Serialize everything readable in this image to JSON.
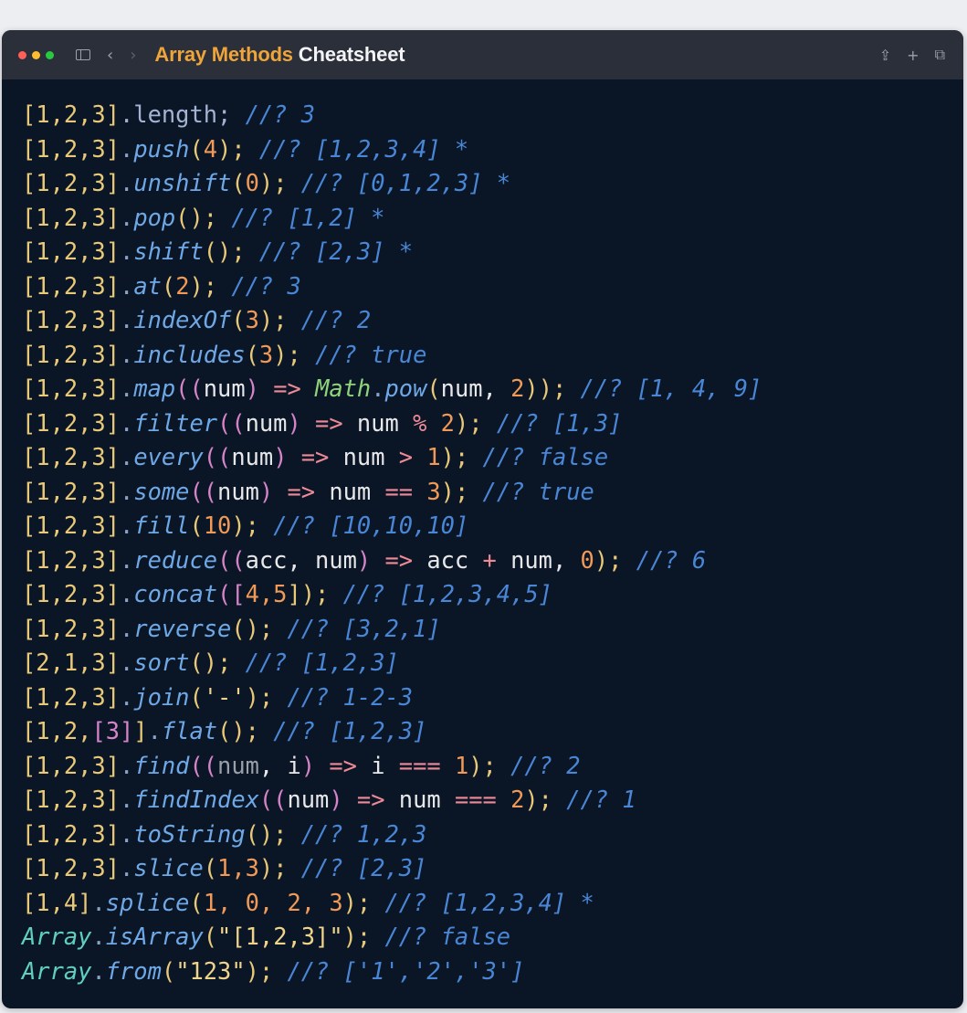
{
  "window": {
    "title_highlight": "Array Methods",
    "title_rest": "Cheatsheet",
    "traffic_lights": [
      "#ff5f57",
      "#febc2e",
      "#28c840"
    ],
    "icons": [
      "sidebar-icon",
      "back-icon",
      "forward-icon",
      "share-icon",
      "plus-icon",
      "tabs-icon"
    ],
    "glyphs": {
      "back": "‹",
      "forward": "›",
      "share": "⇪",
      "plus": "+",
      "tabs": "⧉"
    }
  },
  "colors": {
    "background": "#0a1626",
    "titlebar": "#2a2f39",
    "title_accent": "#f0a53a"
  },
  "code_lines": [
    [
      [
        "[1,2,3]",
        "y"
      ],
      [
        ".length;",
        "k"
      ],
      [
        " //? 3",
        "c"
      ]
    ],
    [
      [
        "[1,2,3]",
        "y"
      ],
      [
        ".",
        "s"
      ],
      [
        "push",
        "m"
      ],
      [
        "(",
        "y"
      ],
      [
        "4",
        "o"
      ],
      [
        ");",
        "y"
      ],
      [
        " //? [1,2,3,4] *",
        "c"
      ]
    ],
    [
      [
        "[1,2,3]",
        "y"
      ],
      [
        ".",
        "s"
      ],
      [
        "unshift",
        "m"
      ],
      [
        "(",
        "y"
      ],
      [
        "0",
        "o"
      ],
      [
        ");",
        "y"
      ],
      [
        " //? [0,1,2,3] *",
        "c"
      ]
    ],
    [
      [
        "[1,2,3]",
        "y"
      ],
      [
        ".",
        "s"
      ],
      [
        "pop",
        "m"
      ],
      [
        "();",
        "y"
      ],
      [
        " //? [1,2] *",
        "c"
      ]
    ],
    [
      [
        "[1,2,3]",
        "y"
      ],
      [
        ".",
        "s"
      ],
      [
        "shift",
        "m"
      ],
      [
        "();",
        "y"
      ],
      [
        " //? [2,3] *",
        "c"
      ]
    ],
    [
      [
        "[1,2,3]",
        "y"
      ],
      [
        ".",
        "s"
      ],
      [
        "at",
        "m"
      ],
      [
        "(",
        "y"
      ],
      [
        "2",
        "o"
      ],
      [
        ");",
        "y"
      ],
      [
        " //? 3",
        "c"
      ]
    ],
    [
      [
        "[1,2,3]",
        "y"
      ],
      [
        ".",
        "s"
      ],
      [
        "indexOf",
        "m"
      ],
      [
        "(",
        "y"
      ],
      [
        "3",
        "o"
      ],
      [
        ");",
        "y"
      ],
      [
        " //? 2",
        "c"
      ]
    ],
    [
      [
        "[1,2,3]",
        "y"
      ],
      [
        ".",
        "s"
      ],
      [
        "includes",
        "m"
      ],
      [
        "(",
        "y"
      ],
      [
        "3",
        "o"
      ],
      [
        ");",
        "y"
      ],
      [
        " //? true",
        "c"
      ]
    ],
    [
      [
        "[1,2,3]",
        "y"
      ],
      [
        ".",
        "s"
      ],
      [
        "map",
        "m"
      ],
      [
        "((",
        "p"
      ],
      [
        "num",
        "w"
      ],
      [
        ")",
        "p"
      ],
      [
        " => ",
        "r"
      ],
      [
        "Math",
        "g"
      ],
      [
        ".",
        "s"
      ],
      [
        "pow",
        "m"
      ],
      [
        "(",
        "y"
      ],
      [
        "num, ",
        "w"
      ],
      [
        "2",
        "o"
      ],
      [
        "));",
        "y"
      ],
      [
        " //? [1, 4, 9]",
        "c"
      ]
    ],
    [
      [
        "[1,2,3]",
        "y"
      ],
      [
        ".",
        "s"
      ],
      [
        "filter",
        "m"
      ],
      [
        "((",
        "p"
      ],
      [
        "num",
        "w"
      ],
      [
        ")",
        "p"
      ],
      [
        " => ",
        "r"
      ],
      [
        "num ",
        "w"
      ],
      [
        "% ",
        "r"
      ],
      [
        "2",
        "o"
      ],
      [
        ");",
        "y"
      ],
      [
        " //? [1,3]",
        "c"
      ]
    ],
    [
      [
        "[1,2,3]",
        "y"
      ],
      [
        ".",
        "s"
      ],
      [
        "every",
        "m"
      ],
      [
        "((",
        "p"
      ],
      [
        "num",
        "w"
      ],
      [
        ")",
        "p"
      ],
      [
        " => ",
        "r"
      ],
      [
        "num ",
        "w"
      ],
      [
        "> ",
        "r"
      ],
      [
        "1",
        "o"
      ],
      [
        ");",
        "y"
      ],
      [
        " //? false",
        "c"
      ]
    ],
    [
      [
        "[1,2,3]",
        "y"
      ],
      [
        ".",
        "s"
      ],
      [
        "some",
        "m"
      ],
      [
        "((",
        "p"
      ],
      [
        "num",
        "w"
      ],
      [
        ")",
        "p"
      ],
      [
        " => ",
        "r"
      ],
      [
        "num ",
        "w"
      ],
      [
        "== ",
        "r"
      ],
      [
        "3",
        "o"
      ],
      [
        ");",
        "y"
      ],
      [
        " //? true",
        "c"
      ]
    ],
    [
      [
        "[1,2,3]",
        "y"
      ],
      [
        ".",
        "s"
      ],
      [
        "fill",
        "m"
      ],
      [
        "(",
        "y"
      ],
      [
        "10",
        "o"
      ],
      [
        ");",
        "y"
      ],
      [
        " //? [10,10,10]",
        "c"
      ]
    ],
    [
      [
        "[1,2,3]",
        "y"
      ],
      [
        ".",
        "s"
      ],
      [
        "reduce",
        "m"
      ],
      [
        "((",
        "p"
      ],
      [
        "acc, num",
        "w"
      ],
      [
        ")",
        "p"
      ],
      [
        " => ",
        "r"
      ],
      [
        "acc ",
        "w"
      ],
      [
        "+ ",
        "r"
      ],
      [
        "num, ",
        "w"
      ],
      [
        "0",
        "o"
      ],
      [
        ");",
        "y"
      ],
      [
        " //? 6",
        "c"
      ]
    ],
    [
      [
        "[1,2,3]",
        "y"
      ],
      [
        ".",
        "s"
      ],
      [
        "concat",
        "m"
      ],
      [
        "([",
        "p"
      ],
      [
        "4,5",
        "o"
      ],
      [
        "]);",
        "y"
      ],
      [
        " //? [1,2,3,4,5]",
        "c"
      ]
    ],
    [
      [
        "[1,2,3]",
        "y"
      ],
      [
        ".",
        "s"
      ],
      [
        "reverse",
        "m"
      ],
      [
        "();",
        "y"
      ],
      [
        " //? [3,2,1]",
        "c"
      ]
    ],
    [
      [
        "[2,1,3]",
        "y"
      ],
      [
        ".",
        "s"
      ],
      [
        "sort",
        "m"
      ],
      [
        "();",
        "y"
      ],
      [
        " //? [1,2,3]",
        "c"
      ]
    ],
    [
      [
        "[1,2,3]",
        "y"
      ],
      [
        ".",
        "s"
      ],
      [
        "join",
        "m"
      ],
      [
        "(",
        "y"
      ],
      [
        "'-'",
        "q"
      ],
      [
        ");",
        "y"
      ],
      [
        " //? 1-2-3",
        "c"
      ]
    ],
    [
      [
        "[1,2,",
        "y"
      ],
      [
        "[3]",
        "p"
      ],
      [
        "]",
        "y"
      ],
      [
        ".",
        "s"
      ],
      [
        "flat",
        "m"
      ],
      [
        "();",
        "y"
      ],
      [
        " //? [1,2,3]",
        "c"
      ]
    ],
    [
      [
        "[1,2,3]",
        "y"
      ],
      [
        ".",
        "s"
      ],
      [
        "find",
        "m"
      ],
      [
        "((",
        "p"
      ],
      [
        "num",
        "d"
      ],
      [
        ", i",
        "w"
      ],
      [
        ")",
        "p"
      ],
      [
        " => ",
        "r"
      ],
      [
        "i ",
        "w"
      ],
      [
        "=== ",
        "r"
      ],
      [
        "1",
        "o"
      ],
      [
        ");",
        "y"
      ],
      [
        " //? 2",
        "c"
      ]
    ],
    [
      [
        "[1,2,3]",
        "y"
      ],
      [
        ".",
        "s"
      ],
      [
        "findIndex",
        "m"
      ],
      [
        "((",
        "p"
      ],
      [
        "num",
        "w"
      ],
      [
        ")",
        "p"
      ],
      [
        " => ",
        "r"
      ],
      [
        "num ",
        "w"
      ],
      [
        "=== ",
        "r"
      ],
      [
        "2",
        "o"
      ],
      [
        ");",
        "y"
      ],
      [
        " //? 1",
        "c"
      ]
    ],
    [
      [
        "[1,2,3]",
        "y"
      ],
      [
        ".",
        "s"
      ],
      [
        "toString",
        "m"
      ],
      [
        "();",
        "y"
      ],
      [
        " //? 1,2,3",
        "c"
      ]
    ],
    [
      [
        "[1,2,3]",
        "y"
      ],
      [
        ".",
        "s"
      ],
      [
        "slice",
        "m"
      ],
      [
        "(",
        "y"
      ],
      [
        "1,3",
        "o"
      ],
      [
        ");",
        "y"
      ],
      [
        " //? [2,3]",
        "c"
      ]
    ],
    [
      [
        "[1,4]",
        "y"
      ],
      [
        ".",
        "s"
      ],
      [
        "splice",
        "m"
      ],
      [
        "(",
        "y"
      ],
      [
        "1, 0, 2, 3",
        "o"
      ],
      [
        ");",
        "y"
      ],
      [
        " //? [1,2,3,4] *",
        "c"
      ]
    ],
    [
      [
        "Array",
        "a"
      ],
      [
        ".",
        "s"
      ],
      [
        "isArray",
        "m"
      ],
      [
        "(",
        "y"
      ],
      [
        "\"[1,2,3]\"",
        "q"
      ],
      [
        ");",
        "y"
      ],
      [
        " //? false",
        "c"
      ]
    ],
    [
      [
        "Array",
        "a"
      ],
      [
        ".",
        "s"
      ],
      [
        "from",
        "m"
      ],
      [
        "(",
        "y"
      ],
      [
        "\"123\"",
        "q"
      ],
      [
        ");",
        "y"
      ],
      [
        " //? ['1','2','3']",
        "c"
      ]
    ]
  ]
}
